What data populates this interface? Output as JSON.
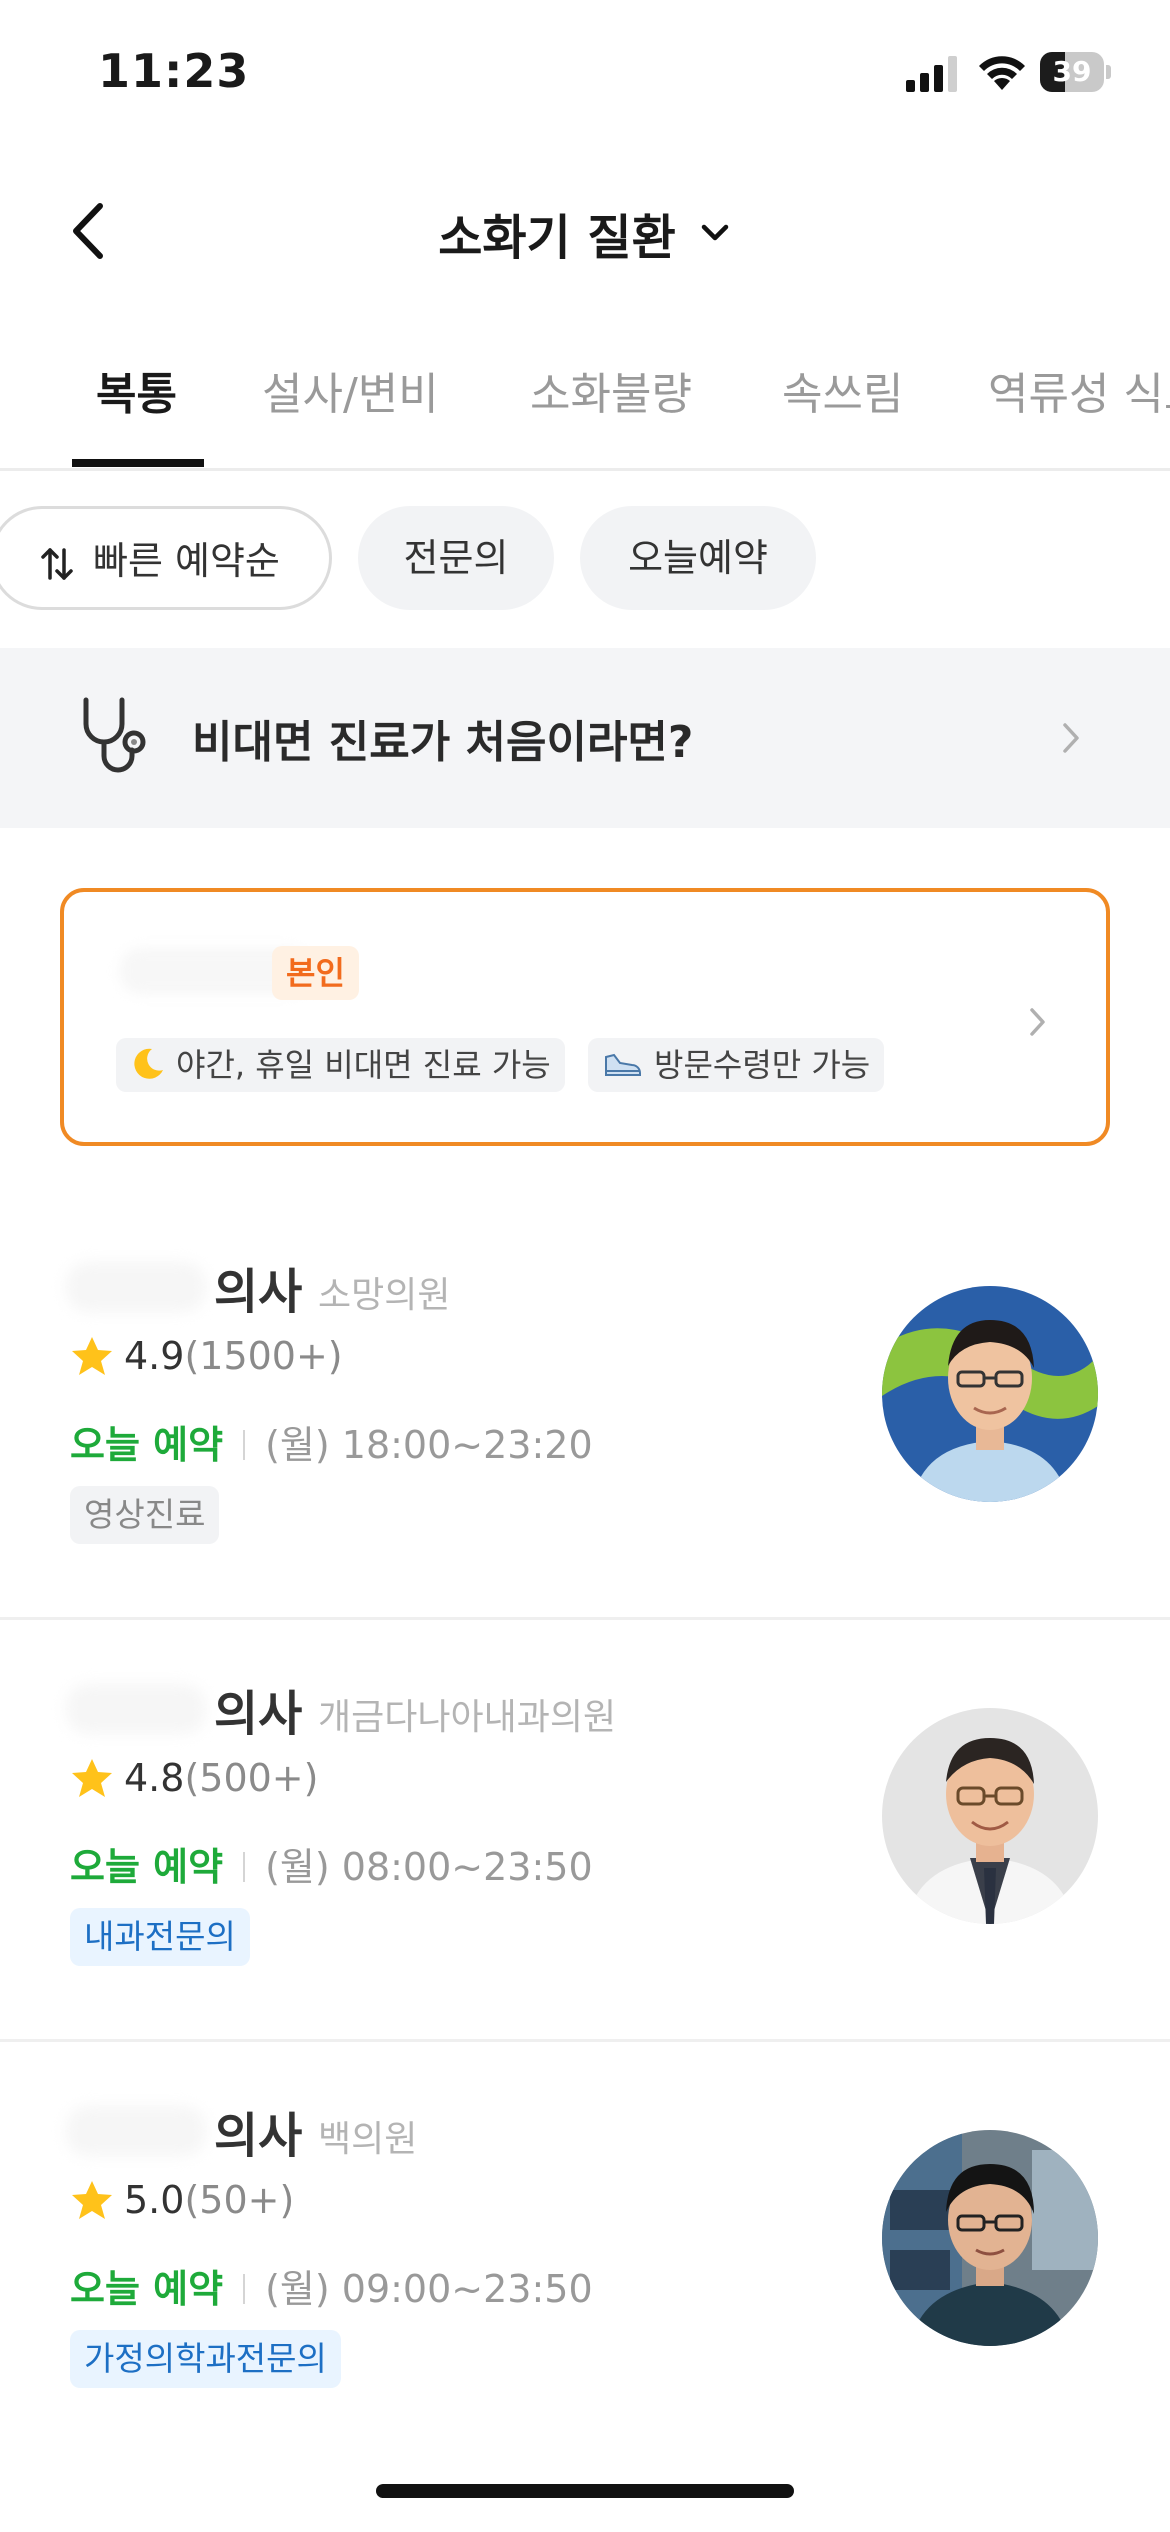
{
  "status_bar": {
    "time": "11:23",
    "battery": "39",
    "battery_level": 0.39
  },
  "header": {
    "title": "소화기 질환"
  },
  "tabs": [
    {
      "label": "복통",
      "active": true
    },
    {
      "label": "설사/변비",
      "active": false
    },
    {
      "label": "소화불량",
      "active": false
    },
    {
      "label": "속쓰림",
      "active": false
    },
    {
      "label": "역류성 식도염",
      "active": false
    }
  ],
  "filters": {
    "sort": "빠른 예약순",
    "specialist": "전문의",
    "today": "오늘예약"
  },
  "banner": {
    "text": "비대면 진료가 처음이라면?"
  },
  "self_card": {
    "badge": "본인",
    "tags": [
      {
        "icon": "moon-icon",
        "label": "야간, 휴일 비대면 진료 가능"
      },
      {
        "icon": "shoe-icon",
        "label": "방문수령만 가능"
      }
    ]
  },
  "doctors": [
    {
      "role": "의사",
      "clinic": "소망의원",
      "rating": "4.9",
      "count": "(1500+)",
      "avail_label": "오늘 예약",
      "hours": "(월) 18:00~23:20",
      "badge": "영상진료",
      "badge_style": "gray"
    },
    {
      "role": "의사",
      "clinic": "개금다나아내과의원",
      "rating": "4.8",
      "count": "(500+)",
      "avail_label": "오늘 예약",
      "hours": "(월) 08:00~23:50",
      "badge": "내과전문의",
      "badge_style": "blue"
    },
    {
      "role": "의사",
      "clinic": "백의원",
      "rating": "5.0",
      "count": "(50+)",
      "avail_label": "오늘 예약",
      "hours": "(월) 09:00~23:50",
      "badge": "가정의학과전문의",
      "badge_style": "blue"
    }
  ],
  "colors": {
    "accent_orange": "#f08a24",
    "available_green": "#1eaa3a",
    "specialist_blue": "#1d6fc4",
    "star": "#ffc21a"
  }
}
